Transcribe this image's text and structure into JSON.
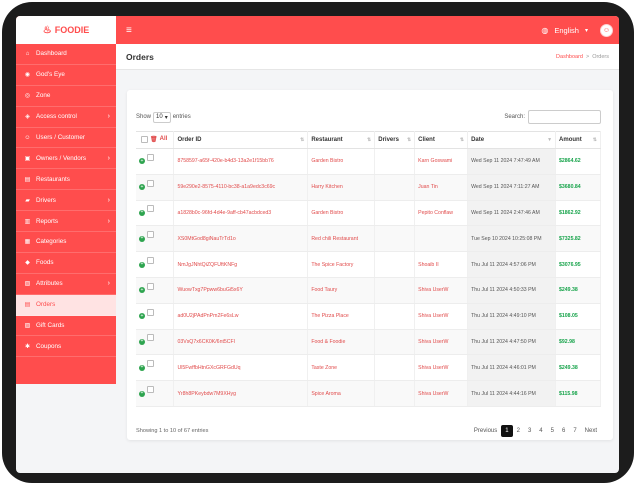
{
  "app": {
    "brand": "FOODIE"
  },
  "topbar": {
    "language": "English"
  },
  "sidebar": {
    "items": [
      {
        "label": "Dashboard",
        "icon": "home-icon",
        "glyph": "⌂",
        "arrow": false
      },
      {
        "label": "God's Eye",
        "icon": "eye-icon",
        "glyph": "◉",
        "arrow": false
      },
      {
        "label": "Zone",
        "icon": "zone-icon",
        "glyph": "◎",
        "arrow": false
      },
      {
        "label": "Access control",
        "icon": "lock-icon",
        "glyph": "◈",
        "arrow": true
      },
      {
        "label": "Users / Customer",
        "icon": "users-icon",
        "glyph": "☺",
        "arrow": false
      },
      {
        "label": "Owners / Vendors",
        "icon": "vendors-icon",
        "glyph": "▣",
        "arrow": true
      },
      {
        "label": "Restaurants",
        "icon": "restaurant-icon",
        "glyph": "▤",
        "arrow": false
      },
      {
        "label": "Drivers",
        "icon": "car-icon",
        "glyph": "▰",
        "arrow": true
      },
      {
        "label": "Reports",
        "icon": "reports-icon",
        "glyph": "▥",
        "arrow": true
      },
      {
        "label": "Categories",
        "icon": "categories-icon",
        "glyph": "▦",
        "arrow": false
      },
      {
        "label": "Foods",
        "icon": "food-icon",
        "glyph": "◆",
        "arrow": false
      },
      {
        "label": "Attributes",
        "icon": "attributes-icon",
        "glyph": "▧",
        "arrow": true
      },
      {
        "label": "Orders",
        "icon": "orders-icon",
        "glyph": "▤",
        "arrow": false,
        "active": true
      },
      {
        "label": "Gift Cards",
        "icon": "gift-icon",
        "glyph": "▨",
        "arrow": false
      },
      {
        "label": "Coupons",
        "icon": "coupon-icon",
        "glyph": "✱",
        "arrow": false
      }
    ]
  },
  "page": {
    "title": "Orders",
    "breadcrumb": [
      "Dashboard",
      "Orders"
    ]
  },
  "table_controls": {
    "show_label": "Show",
    "entries_value": "10",
    "entries_label": "entries",
    "search_label": "Search:"
  },
  "orders_table": {
    "select_all_label": "All",
    "columns": [
      "Order ID",
      "Restaurant",
      "Drivers",
      "Client",
      "Date",
      "Amount"
    ],
    "rows": [
      {
        "id": "8758597-a65f-420e-b4d3-13a2e1f15bb76",
        "restaurant": "Garden Bistro",
        "driver": "",
        "client": "Karn Goswami",
        "date": "Wed Sep 11 2024 7:47:49 AM",
        "amount": "$2864.62"
      },
      {
        "id": "59e290e2-8575-4110-bc38-a1a9edc3c69c",
        "restaurant": "Harry Kitchen",
        "driver": "",
        "client": "Juan Tin",
        "date": "Wed Sep 11 2024 7:11:27 AM",
        "amount": "$3680.84"
      },
      {
        "id": "a1828b0c-96fd-4d4e-9aff-cb47acbdced3",
        "restaurant": "Garden Bistro",
        "driver": "",
        "client": "Pepito Conflaw",
        "date": "Wed Sep 11 2024 2:47:46 AM",
        "amount": "$1862.92"
      },
      {
        "id": "XS0MtGod8giNauTrTd1o",
        "restaurant": "Red chili Restaurant",
        "driver": "",
        "client": "",
        "date": "Tue Sep 10 2024 10:25:08 PM",
        "amount": "$7325.82"
      },
      {
        "id": "NmJgJNhtQiZQFUftKNFg",
        "restaurant": "The Spice Factory",
        "driver": "",
        "client": "Shoaib II",
        "date": "Thu Jul 11 2024 4:57:06 PM",
        "amount": "$3076.95"
      },
      {
        "id": "WuowTxg7Ppww6buGi5x6Y",
        "restaurant": "Food Taury",
        "driver": "",
        "client": "Shiva UserW",
        "date": "Thu Jul 11 2024 4:50:33 PM",
        "amount": "$249.38"
      },
      {
        "id": "ad0U2jPAdPnPm2Fe6sLw",
        "restaurant": "The Pizza Place",
        "driver": "",
        "client": "Shiva UserW",
        "date": "Thu Jul 11 2024 4:49:10 PM",
        "amount": "$108.05"
      },
      {
        "id": "03VsQ7x6CK0K/6nt5CFl",
        "restaurant": "Food & Foodie",
        "driver": "",
        "client": "Shiva UserW",
        "date": "Thu Jul 11 2024 4:47:50 PM",
        "amount": "$92.98"
      },
      {
        "id": "Ul5FwffbHtnGXcGRFGdUq",
        "restaurant": "Taste Zone",
        "driver": "",
        "client": "Shiva UserW",
        "date": "Thu Jul 11 2024 4:46:01 PM",
        "amount": "$249.38"
      },
      {
        "id": "Yr8h8PKeybdw7M9XHyg",
        "restaurant": "Spice Aroma",
        "driver": "",
        "client": "Shiva UserW",
        "date": "Thu Jul 11 2024 4:44:16 PM",
        "amount": "$115.98"
      }
    ]
  },
  "table_footer": {
    "info": "Showing 1 to 10 of 67 entries",
    "previous": "Previous",
    "pages": [
      "1",
      "2",
      "3",
      "4",
      "5",
      "6",
      "7"
    ],
    "current_page": "1",
    "next": "Next"
  },
  "colors": {
    "brand": "#ff4d4d",
    "amount": "#16a34a",
    "link": "#e14b4b"
  }
}
